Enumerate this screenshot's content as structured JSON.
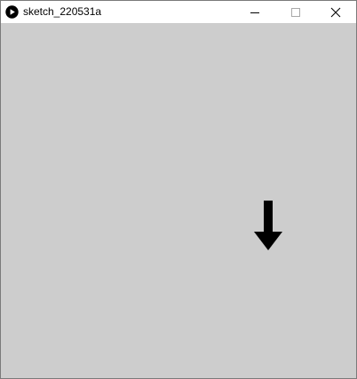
{
  "window": {
    "title": "sketch_220531a",
    "controls": {
      "minimize_icon": "minimize-icon",
      "maximize_icon": "maximize-icon",
      "close_icon": "close-icon"
    }
  },
  "canvas": {
    "background": "#cdcdcd",
    "arrow": {
      "icon": "arrow-down-icon",
      "color": "#000000",
      "direction": "down"
    }
  }
}
